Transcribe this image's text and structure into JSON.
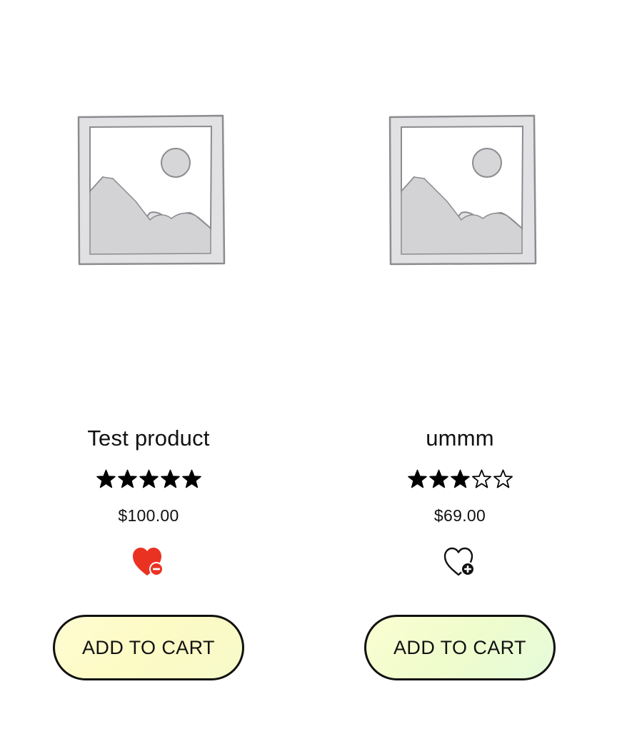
{
  "products": [
    {
      "title": "Test product",
      "rating": 5,
      "rating_max": 5,
      "price": "$100.00",
      "wishlist_icon": "heart-filled-minus-icon",
      "wishlisted": true,
      "cart_label": "ADD TO CART"
    },
    {
      "title": "ummm",
      "rating": 3,
      "rating_max": 5,
      "price": "$69.00",
      "wishlist_icon": "heart-outline-plus-icon",
      "wishlisted": false,
      "cart_label": "ADD TO CART"
    }
  ],
  "colors": {
    "wishlist_active": "#ea3223",
    "star_fill": "#000000",
    "text": "#111111",
    "placeholder_fill": "#dcdcde",
    "placeholder_stroke": "#8a8a8e"
  }
}
